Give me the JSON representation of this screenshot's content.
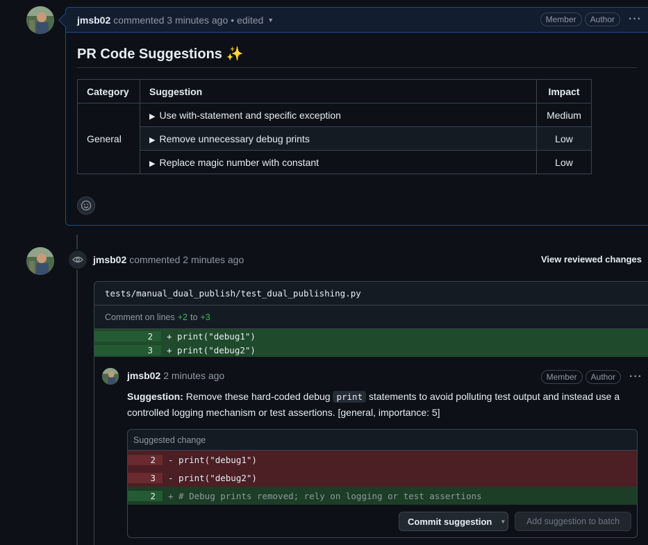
{
  "comment1": {
    "author": "jmsb02",
    "meta": "commented 3 minutes ago",
    "edited": "edited",
    "badges": [
      "Member",
      "Author"
    ],
    "title": "PR Code Suggestions ✨",
    "table": {
      "headers": [
        "Category",
        "Suggestion",
        "Impact"
      ],
      "category": "General",
      "rows": [
        {
          "suggestion": "Use with-statement and specific exception",
          "impact": "Medium"
        },
        {
          "suggestion": "Remove unnecessary debug prints",
          "impact": "Low"
        },
        {
          "suggestion": "Replace magic number with constant",
          "impact": "Low"
        }
      ]
    }
  },
  "comment2": {
    "author": "jmsb02",
    "meta": "commented 2 minutes ago",
    "view_changes": "View reviewed changes",
    "file": "tests/manual_dual_publish/test_dual_publishing.py",
    "lines_prefix": "Comment on lines",
    "lines_from": "+2",
    "lines_to_word": "to",
    "lines_to": "+3",
    "diff": [
      {
        "num": "2",
        "code": "+ print(\"debug1\")"
      },
      {
        "num": "3",
        "code": "+ print(\"debug2\")"
      }
    ],
    "review": {
      "author": "jmsb02",
      "meta": "2 minutes ago",
      "badges": [
        "Member",
        "Author"
      ],
      "bold": "Suggestion:",
      "text_before": "Remove these hard-coded debug",
      "code": "print",
      "text_after": "statements to avoid polluting test output and instead use a controlled logging mechanism or test assertions. [general, importance: 5]",
      "suggested_header": "Suggested change",
      "suggested_rows": [
        {
          "type": "del",
          "num": "2",
          "code": "- print(\"debug1\")"
        },
        {
          "type": "del",
          "num": "3",
          "code": "- print(\"debug2\")"
        },
        {
          "type": "add",
          "num": "2",
          "code": "+ # Debug prints removed; rely on logging or test assertions"
        }
      ],
      "commit_label": "Commit suggestion",
      "batch_label": "Add suggestion to batch"
    }
  }
}
